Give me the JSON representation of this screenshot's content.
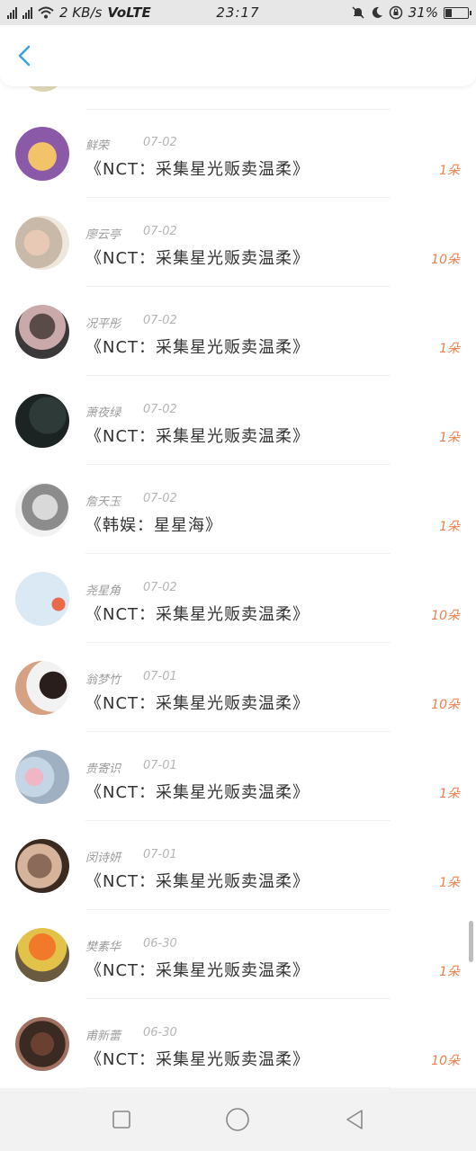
{
  "status_bar": {
    "network_speed": "2 KB/s",
    "network_type": "VoLTE",
    "time": "23:17",
    "battery_percent": "31%"
  },
  "colors": {
    "accent_back": "#3aa0e0",
    "count_orange": "#f07f4a"
  },
  "list": {
    "items": [
      {
        "name": "鲜荣",
        "date": "07-02",
        "title": "《NCT：采集星光贩卖温柔》",
        "count": "1朵",
        "avatar_icon": "cartoon-avatar"
      },
      {
        "name": "廖云亭",
        "date": "07-02",
        "title": "《NCT：采集星光贩卖温柔》",
        "count": "10朵",
        "avatar_icon": "photo-avatar"
      },
      {
        "name": "况平彤",
        "date": "07-02",
        "title": "《NCT：采集星光贩卖温柔》",
        "count": "1朵",
        "avatar_icon": "photo-avatar"
      },
      {
        "name": "萧夜绿",
        "date": "07-02",
        "title": "《NCT：采集星光贩卖温柔》",
        "count": "1朵",
        "avatar_icon": "photo-avatar"
      },
      {
        "name": "詹天玉",
        "date": "07-02",
        "title": "《韩娱：星星海》",
        "count": "1朵",
        "avatar_icon": "photo-avatar"
      },
      {
        "name": "尧星角",
        "date": "07-02",
        "title": "《NCT：采集星光贩卖温柔》",
        "count": "10朵",
        "avatar_icon": "photo-avatar"
      },
      {
        "name": "翁梦竹",
        "date": "07-01",
        "title": "《NCT：采集星光贩卖温柔》",
        "count": "10朵",
        "avatar_icon": "photo-avatar"
      },
      {
        "name": "贵寄识",
        "date": "07-01",
        "title": "《NCT：采集星光贩卖温柔》",
        "count": "1朵",
        "avatar_icon": "photo-avatar"
      },
      {
        "name": "闵诗妍",
        "date": "07-01",
        "title": "《NCT：采集星光贩卖温柔》",
        "count": "1朵",
        "avatar_icon": "photo-avatar"
      },
      {
        "name": "樊素华",
        "date": "06-30",
        "title": "《NCT：采集星光贩卖温柔》",
        "count": "1朵",
        "avatar_icon": "photo-avatar"
      },
      {
        "name": "甫新蕾",
        "date": "06-30",
        "title": "《NCT：采集星光贩卖温柔》",
        "count": "10朵",
        "avatar_icon": "photo-avatar"
      }
    ]
  },
  "nav_bar": {
    "icons": [
      "recents-square-icon",
      "home-circle-icon",
      "back-triangle-icon"
    ]
  }
}
